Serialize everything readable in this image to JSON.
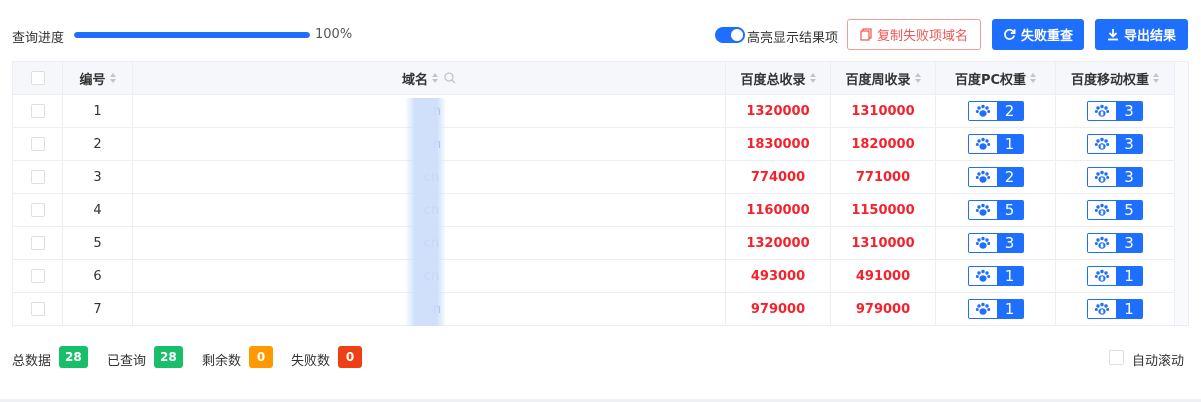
{
  "progress": {
    "label": "查询进度",
    "percent": 100,
    "text": "100%"
  },
  "toolbar": {
    "highlight_label": "高亮显示结果项",
    "highlight_on": true,
    "copy_label": "复制失败项域名",
    "retry_label": "失败重查",
    "export_label": "导出结果"
  },
  "table": {
    "headers": {
      "index": "编号",
      "domain": "域名",
      "total": "百度总收录",
      "weekly": "百度周收录",
      "pc": "百度PC权重",
      "mobile": "百度移动权重"
    },
    "rows": [
      {
        "index": "1",
        "domain": "n",
        "total": "1320000",
        "weekly": "1310000",
        "pc": "2",
        "mobile": "3"
      },
      {
        "index": "2",
        "domain": "n",
        "total": "1830000",
        "weekly": "1820000",
        "pc": "1",
        "mobile": "3"
      },
      {
        "index": "3",
        "domain": "cn",
        "total": "774000",
        "weekly": "771000",
        "pc": "2",
        "mobile": "3"
      },
      {
        "index": "4",
        "domain": "cn",
        "total": "1160000",
        "weekly": "1150000",
        "pc": "5",
        "mobile": "5"
      },
      {
        "index": "5",
        "domain": "cn",
        "total": "1320000",
        "weekly": "1310000",
        "pc": "3",
        "mobile": "3"
      },
      {
        "index": "6",
        "domain": "cn",
        "total": "493000",
        "weekly": "491000",
        "pc": "1",
        "mobile": "1"
      },
      {
        "index": "7",
        "domain": "n",
        "total": "979000",
        "weekly": "979000",
        "pc": "1",
        "mobile": "1"
      }
    ]
  },
  "stats": {
    "total_label": "总数据",
    "total": "28",
    "done_label": "已查询",
    "done": "28",
    "remain_label": "剩余数",
    "remain": "0",
    "fail_label": "失败数",
    "fail": "0"
  },
  "auto_scroll_label": "自动滚动",
  "colors": {
    "primary": "#1f6fff",
    "red": "#f5222d",
    "green": "#19be6b",
    "orange": "#ff9900",
    "fail": "#ed4014"
  }
}
